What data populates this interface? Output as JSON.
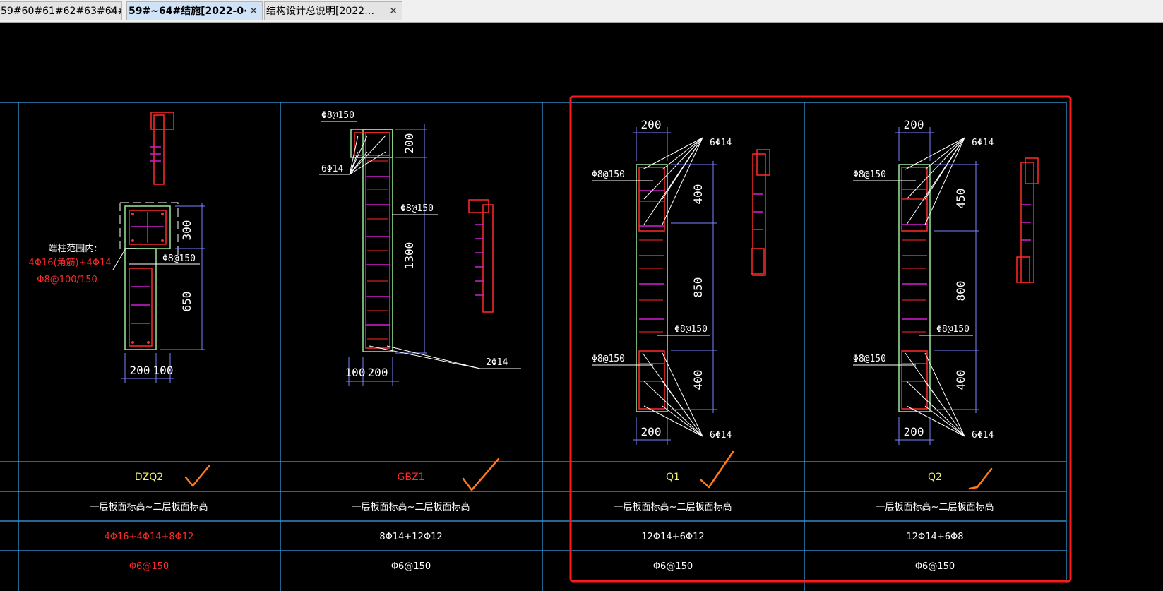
{
  "tabs": [
    {
      "label": "59#60#61#62#63#64#…",
      "active": false
    },
    {
      "label": "59#~64#结施[2022-0·",
      "active": true
    },
    {
      "label": "结构设计总说明[2022…",
      "active": false
    }
  ],
  "close_glyph": "✕",
  "colors": {
    "grid": "#3aa5e6",
    "wall": "#9ae89a",
    "rebar": "#ff2a2a",
    "tie": "#d21ed2",
    "dim": "#7b85ff",
    "text": "#ffffff",
    "yellow": "#f4f066",
    "red_text": "#ff2a2a",
    "check": "#ff7a1a",
    "highlight": "#ff1a1a"
  },
  "drawings": {
    "dzq2": {
      "dim_top": "300",
      "dim_bottom": "650",
      "dim_w1": "200",
      "dim_w2": "100",
      "stirrup": "Φ8@150",
      "note_title": "端柱范围内:",
      "note_bars": "4Φ16(角筋)+4Φ14",
      "note_stirrup": "Φ8@100/150"
    },
    "gbz1": {
      "top_stirrup": "Φ8@150",
      "dim_top": "200",
      "left_bars": "6Φ14",
      "mid_stirrup": "Φ8@150",
      "dim_mid": "1300",
      "bottom_bars": "2Φ14",
      "dim_w1": "100",
      "dim_w2": "200"
    },
    "q1": {
      "dim_width_top": "200",
      "bars_top": "6Φ14",
      "stirrup_top": "Φ8@150",
      "dim_seg1": "400",
      "dim_seg2": "850",
      "stirrup_mid": "Φ8@150",
      "stirrup_low": "Φ8@150",
      "dim_seg3": "400",
      "dim_width_bottom": "200",
      "bars_bottom": "6Φ14"
    },
    "q2": {
      "dim_width_top": "200",
      "bars_top": "6Φ14",
      "stirrup_top": "Φ8@150",
      "dim_seg1": "450",
      "dim_seg2": "800",
      "stirrup_mid": "Φ8@150",
      "stirrup_low": "Φ8@150",
      "dim_seg3": "400",
      "dim_width_bottom": "200",
      "bars_bottom": "6Φ14"
    }
  },
  "table": {
    "names": [
      "DZQ2",
      "GBZ1",
      "Q1",
      "Q2"
    ],
    "elevation": [
      "一层板面标高~二层板面标高",
      "一层板面标高~二层板面标高",
      "一层板面标高~二层板面标高",
      "一层板面标高~二层板面标高"
    ],
    "longitudinal": [
      "4Φ16+4Φ14+8Φ12",
      "8Φ14+12Φ12",
      "12Φ14+6Φ12",
      "12Φ14+6Φ8"
    ],
    "stirrups": [
      "Φ6@150",
      "Φ6@150",
      "Φ6@150",
      "Φ6@150"
    ]
  }
}
